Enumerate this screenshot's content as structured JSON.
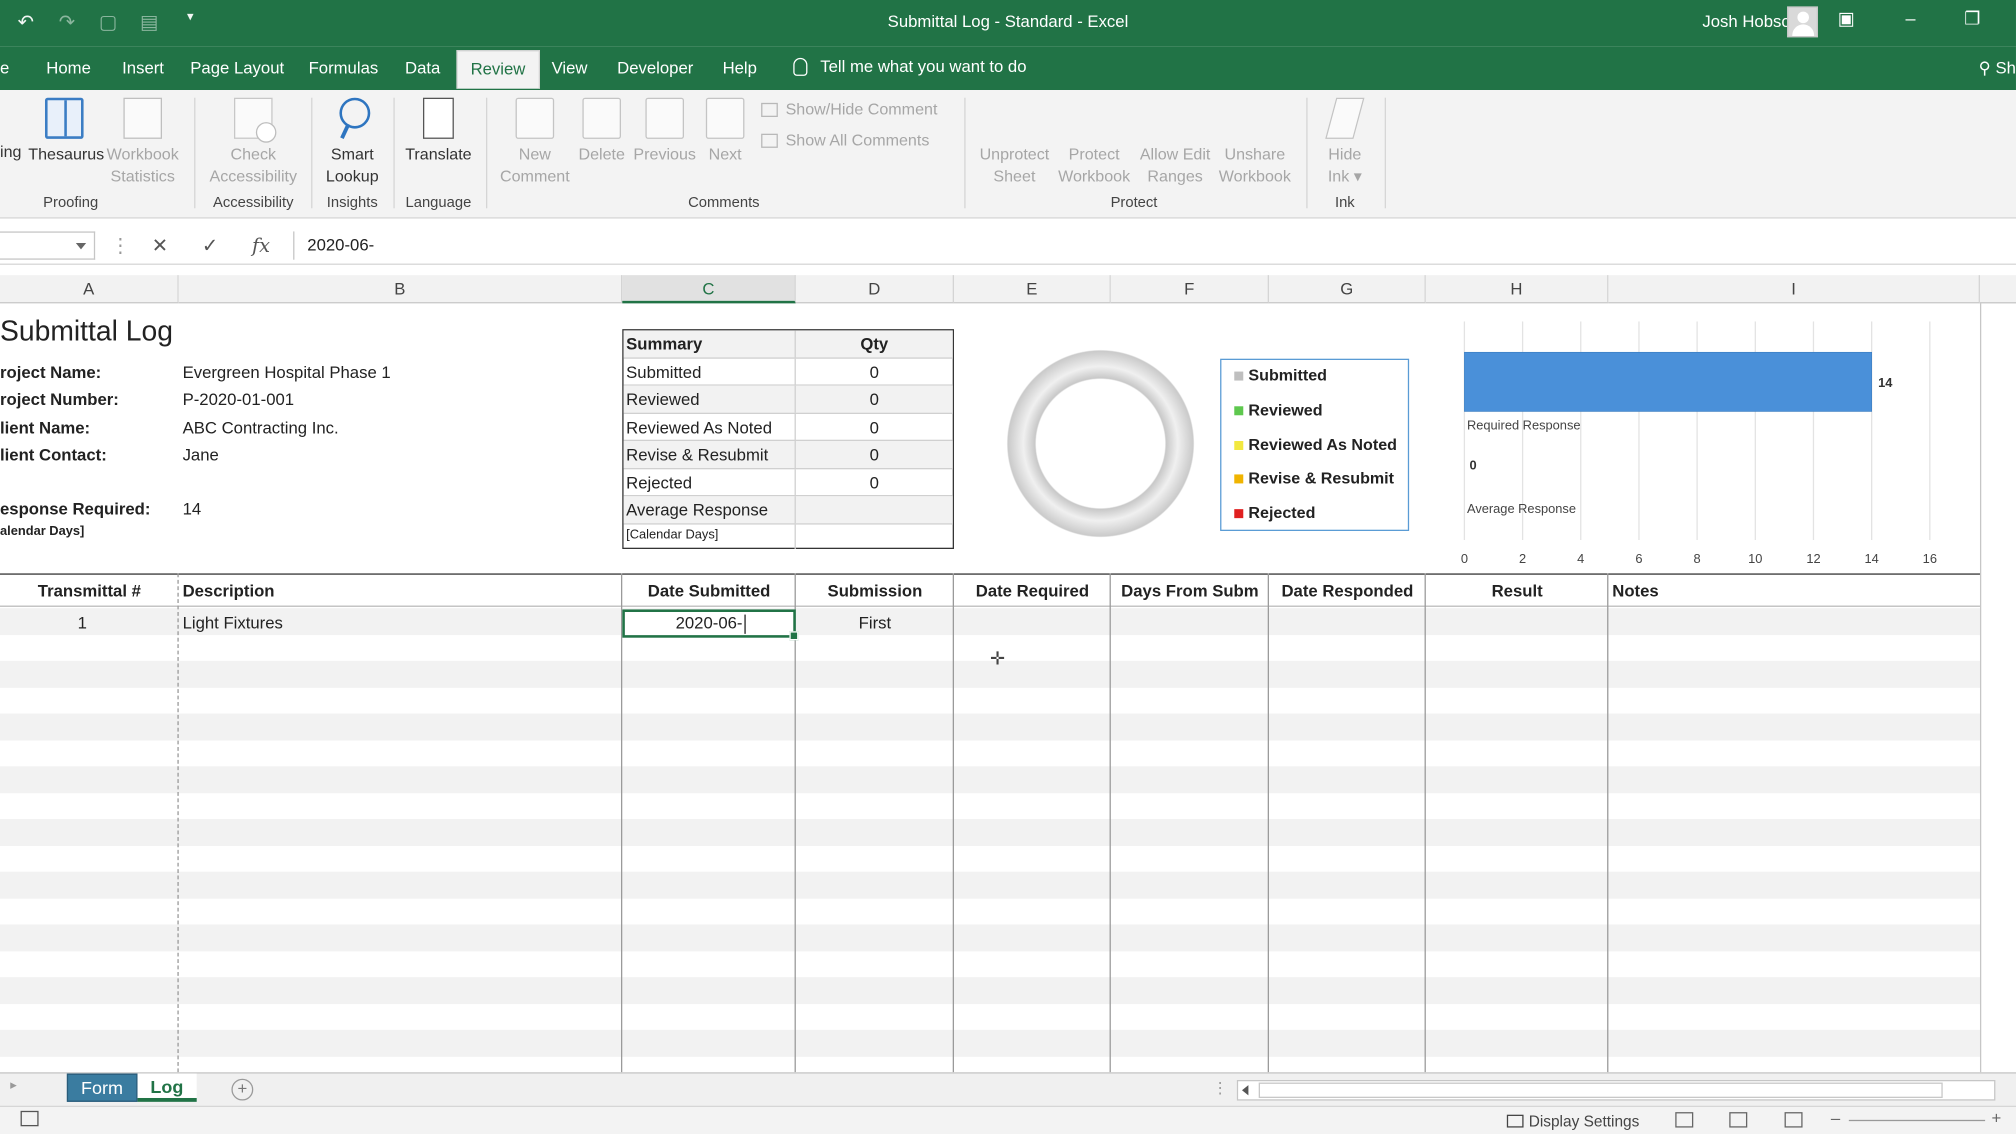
{
  "titlebar": {
    "title": "Submittal Log - Standard  -  Excel",
    "user": "Josh Hobson",
    "qat": [
      "undo-icon",
      "redo-icon",
      "print-preview-icon",
      "form-icon",
      "customize-icon"
    ]
  },
  "menu": {
    "items": [
      "Home",
      "Insert",
      "Page Layout",
      "Formulas",
      "Data",
      "Review",
      "View",
      "Developer",
      "Help"
    ],
    "active": "Review",
    "tellme": "Tell me what you want to do",
    "share": "Sh"
  },
  "ribbon": {
    "proofing": {
      "partial": "ing",
      "thesaurus": "Thesaurus",
      "stats1": "Workbook",
      "stats2": "Statistics",
      "label": "Proofing"
    },
    "accessibility": {
      "b1": "Check",
      "b2": "Accessibility",
      "label": "Accessibility"
    },
    "insights": {
      "b1": "Smart",
      "b2": "Lookup",
      "label": "Insights"
    },
    "language": {
      "b1": "Translate",
      "label": "Language"
    },
    "comments": {
      "new1": "New",
      "new2": "Comment",
      "delete": "Delete",
      "previous": "Previous",
      "next": "Next",
      "showhide": "Show/Hide Comment",
      "showall": "Show All Comments",
      "label": "Comments"
    },
    "protect": {
      "unprotect1": "Unprotect",
      "unprotect2": "Sheet",
      "protectwb1": "Protect",
      "protectwb2": "Workbook",
      "allow1": "Allow Edit",
      "allow2": "Ranges",
      "unshare1": "Unshare",
      "unshare2": "Workbook",
      "label": "Protect"
    },
    "ink": {
      "b1": "Hide",
      "b2": "Ink",
      "label": "Ink"
    }
  },
  "formula_bar": {
    "value": "2020-06-"
  },
  "columns": [
    "A",
    "B",
    "C",
    "D",
    "E",
    "F",
    "G",
    "H",
    "I"
  ],
  "header_info": {
    "title": "Submittal Log",
    "project_name_label": "roject Name:",
    "project_name": "Evergreen Hospital Phase 1",
    "project_number_label": "roject Number:",
    "project_number": "P-2020-01-001",
    "client_name_label": "lient Name:",
    "client_name": "ABC Contracting Inc.",
    "client_contact_label": "lient Contact:",
    "client_contact": "Jane",
    "response_label": "esponse Required:",
    "response_value": "14",
    "response_unit": "alendar Days]"
  },
  "summary": {
    "head": [
      "Summary",
      "Qty"
    ],
    "rows": [
      [
        "Submitted",
        "0"
      ],
      [
        "Reviewed",
        "0"
      ],
      [
        "Reviewed As Noted",
        "0"
      ],
      [
        "Revise & Resubmit",
        "0"
      ],
      [
        "Rejected",
        "0"
      ],
      [
        "Average Response",
        ""
      ]
    ],
    "footnote": "[Calendar Days]"
  },
  "legend": [
    {
      "label": "Submitted",
      "color": "#bfbfbf"
    },
    {
      "label": "Reviewed",
      "color": "#5ec84e"
    },
    {
      "label": "Reviewed As Noted",
      "color": "#f2e840"
    },
    {
      "label": "Revise & Resubmit",
      "color": "#f0b400"
    },
    {
      "label": "Rejected",
      "color": "#e02020"
    }
  ],
  "chart_data": {
    "type": "bar",
    "orientation": "horizontal",
    "categories": [
      "Required Response",
      "Average Response"
    ],
    "values": [
      14,
      0
    ],
    "data_labels": [
      "14",
      "0"
    ],
    "xlim": [
      0,
      16
    ],
    "xticks": [
      "0",
      "2",
      "4",
      "6",
      "8",
      "10",
      "12",
      "14",
      "16"
    ],
    "bar_color": "#4a90d9",
    "grid": true
  },
  "grid": {
    "headers": [
      "Transmittal #",
      "Description",
      "Date Submitted",
      "Submission",
      "Date Required",
      "Days From Subm",
      "Date Responded",
      "Result",
      "Notes"
    ],
    "rows": [
      {
        "transmittal": "1",
        "description": "Light Fixtures",
        "date_submitted": "2020-06-",
        "submission": "First"
      }
    ]
  },
  "sheet_tabs": [
    "Form",
    "Log"
  ],
  "active_sheet": "Log",
  "status": {
    "display_settings": "Display Settings"
  }
}
